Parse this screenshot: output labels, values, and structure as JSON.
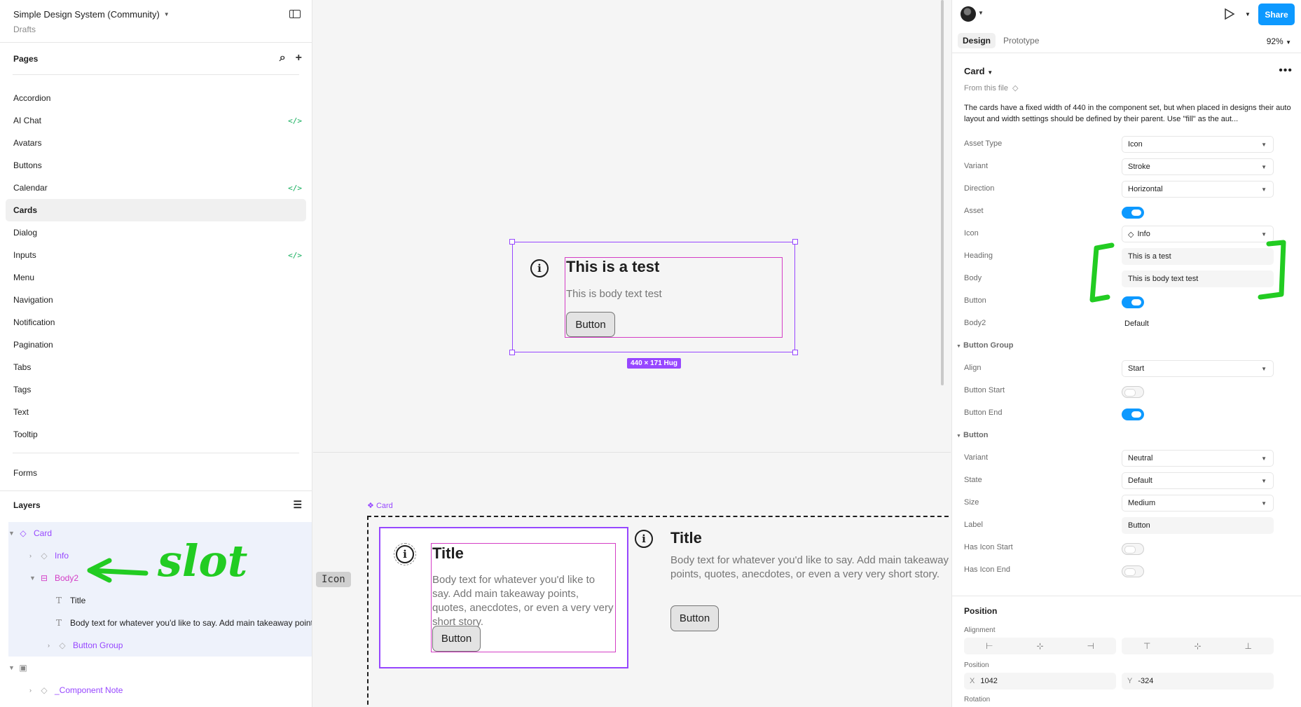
{
  "file": {
    "title": "Simple Design System (Community)",
    "subtitle": "Drafts"
  },
  "pages": {
    "heading": "Pages",
    "items": [
      {
        "label": "Accordion",
        "code": false
      },
      {
        "label": "AI Chat",
        "code": true
      },
      {
        "label": "Avatars",
        "code": false
      },
      {
        "label": "Buttons",
        "code": false
      },
      {
        "label": "Calendar",
        "code": true
      },
      {
        "label": "Cards",
        "code": false,
        "active": true
      },
      {
        "label": "Dialog",
        "code": false
      },
      {
        "label": "Inputs",
        "code": true
      },
      {
        "label": "Menu",
        "code": false
      },
      {
        "label": "Navigation",
        "code": false
      },
      {
        "label": "Notification",
        "code": false
      },
      {
        "label": "Pagination",
        "code": false
      },
      {
        "label": "Tabs",
        "code": false
      },
      {
        "label": "Tags",
        "code": false
      },
      {
        "label": "Text",
        "code": false
      },
      {
        "label": "Tooltip",
        "code": false
      }
    ],
    "code_glyph": "</>",
    "forms": "Forms"
  },
  "layers": {
    "heading": "Layers",
    "items": [
      "Card",
      "Info",
      "Body2",
      "Title",
      "Body text for whatever you'd like to say. Add main takeaway points",
      "Button Group",
      "_Component Note"
    ],
    "annotation": "slot"
  },
  "canvas": {
    "card": {
      "heading": "This is a test",
      "body": "This is body text test",
      "button": "Button",
      "size": "440 × 171 Hug"
    },
    "component_label": "Card",
    "variant1": {
      "title": "Title",
      "body": "Body text for whatever you'd like to say. Add main takeaway points, quotes, anecdotes, or even a very very short story.",
      "button": "Button"
    },
    "variant2": {
      "title": "Title",
      "body": "Body text for whatever you'd like to say. Add main takeaway points, quotes, anecdotes, or even a very very short story.",
      "button": "Button"
    },
    "icon_pill": "Icon"
  },
  "right": {
    "share": "Share",
    "tabs": [
      "Design",
      "Prototype"
    ],
    "zoom": "92%",
    "component": "Card",
    "from_file": "From this file",
    "description": "The cards have a fixed width of 440 in the component set, but when placed in designs their auto layout and width settings should be defined by their parent. Use \"fill\" as the aut...",
    "props": {
      "asset_type": {
        "label": "Asset Type",
        "value": "Icon"
      },
      "variant": {
        "label": "Variant",
        "value": "Stroke"
      },
      "direction": {
        "label": "Direction",
        "value": "Horizontal"
      },
      "asset": {
        "label": "Asset"
      },
      "icon": {
        "label": "Icon",
        "value": "Info"
      },
      "heading": {
        "label": "Heading",
        "value": "This is a test"
      },
      "body": {
        "label": "Body",
        "value": "This is body text test"
      },
      "button": {
        "label": "Button"
      },
      "body2": {
        "label": "Body2",
        "value": "Default"
      }
    },
    "button_group": {
      "heading": "Button Group",
      "align": {
        "label": "Align",
        "value": "Start"
      },
      "button_start": {
        "label": "Button Start"
      },
      "button_end": {
        "label": "Button End"
      }
    },
    "button": {
      "heading": "Button",
      "variant": {
        "label": "Variant",
        "value": "Neutral"
      },
      "state": {
        "label": "State",
        "value": "Default"
      },
      "size": {
        "label": "Size",
        "value": "Medium"
      },
      "label": {
        "label": "Label",
        "value": "Button"
      },
      "has_icon_start": {
        "label": "Has Icon Start"
      },
      "has_icon_end": {
        "label": "Has Icon End"
      }
    },
    "position": {
      "heading": "Position",
      "alignment": "Alignment",
      "position": "Position",
      "x_key": "X",
      "x": "1042",
      "y_key": "Y",
      "y": "-324",
      "rotation": "Rotation"
    }
  },
  "colors": {
    "accent": "#9747ff",
    "blue": "#0d99ff",
    "slot": "#22cc22"
  }
}
